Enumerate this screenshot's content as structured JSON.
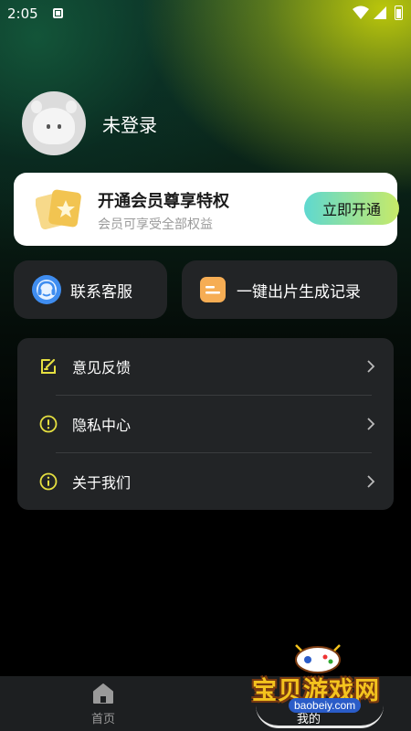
{
  "status_bar": {
    "time": "2:05"
  },
  "profile": {
    "username": "未登录"
  },
  "vip_card": {
    "title": "开通会员尊享特权",
    "subtitle": "会员可享受全部权益",
    "button": "立即开通"
  },
  "quick_actions": {
    "service": "联系客服",
    "records": "一键出片生成记录"
  },
  "menu": {
    "items": [
      {
        "label": "意见反馈",
        "icon": "edit-icon"
      },
      {
        "label": "隐私中心",
        "icon": "exclamation-circle-icon"
      },
      {
        "label": "关于我们",
        "icon": "info-circle-icon"
      }
    ]
  },
  "bottom_nav": {
    "home": "首页",
    "mine": "我的"
  },
  "watermark": {
    "brand": "宝贝游戏网",
    "domain": "baobeiy.com"
  },
  "colors": {
    "accent_yellow": "#e6e040",
    "card_bg": "#222426",
    "vip_button_start": "#5ed8d0",
    "vip_button_end": "#c8ea68"
  }
}
